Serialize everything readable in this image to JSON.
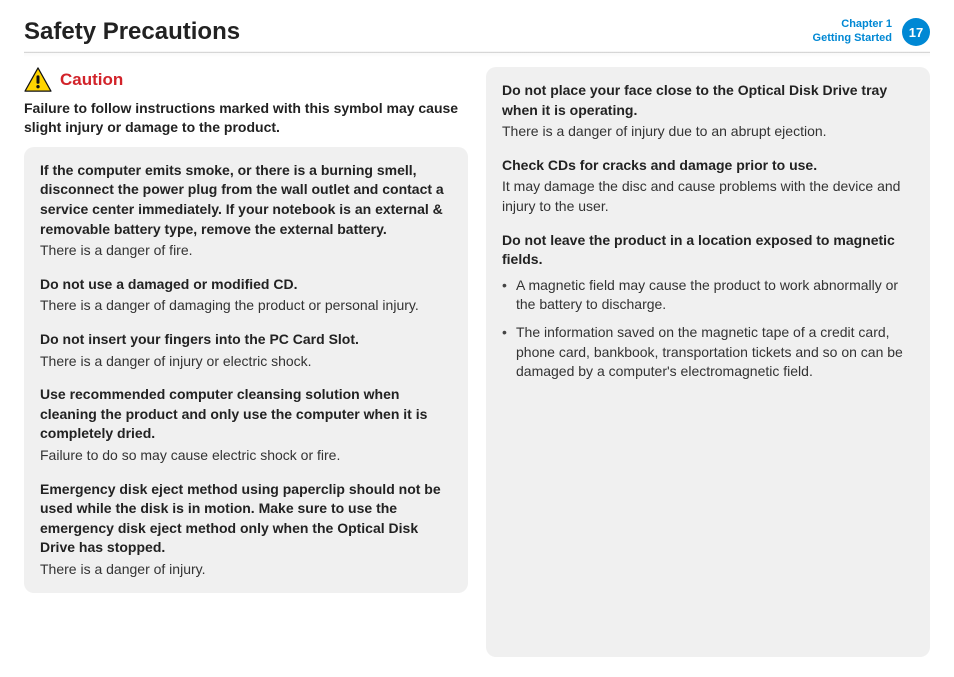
{
  "header": {
    "title": "Safety Precautions",
    "chapter_line1": "Chapter 1",
    "chapter_line2": "Getting Started",
    "page_num": "17"
  },
  "caution": {
    "label": "Caution",
    "intro": "Failure to follow instructions marked with this symbol may cause slight injury or damage to the product."
  },
  "left": [
    {
      "h": "If the computer emits smoke, or there is a burning smell, disconnect the power plug from the wall outlet and contact a service center immediately. If your notebook is an external & removable battery type, remove the external battery.",
      "d": "There is a danger of fire."
    },
    {
      "h": "Do not use a damaged or modified CD.",
      "d": "There is a danger of damaging the product or personal injury."
    },
    {
      "h": "Do not insert your fingers into the PC Card Slot.",
      "d": "There is a danger of injury or electric shock."
    },
    {
      "h": "Use recommended computer cleansing solution when cleaning the product and only use the computer when it is completely dried.",
      "d": "Failure to do so may cause electric shock or fire."
    },
    {
      "h": "Emergency disk eject method using paperclip should not be used while the disk is in motion. Make sure to use the emergency disk eject method only when the Optical Disk Drive has stopped.",
      "d": "There is a danger of injury."
    }
  ],
  "right": [
    {
      "h": "Do not place your face close to the Optical Disk Drive tray when it is operating.",
      "d": "There is a danger of injury due to an abrupt ejection."
    },
    {
      "h": "Check CDs for cracks and damage prior to use.",
      "d": "It may damage the disc and cause problems with the device and injury to the user."
    },
    {
      "h": "Do not leave the product in a location exposed to magnetic fields.",
      "list": [
        "A magnetic field may cause the product to work abnormally or the battery to discharge.",
        "The information saved on the magnetic tape of a credit card, phone card, bankbook, transportation tickets and so on can be damaged by a computer's electromagnetic field."
      ]
    }
  ]
}
